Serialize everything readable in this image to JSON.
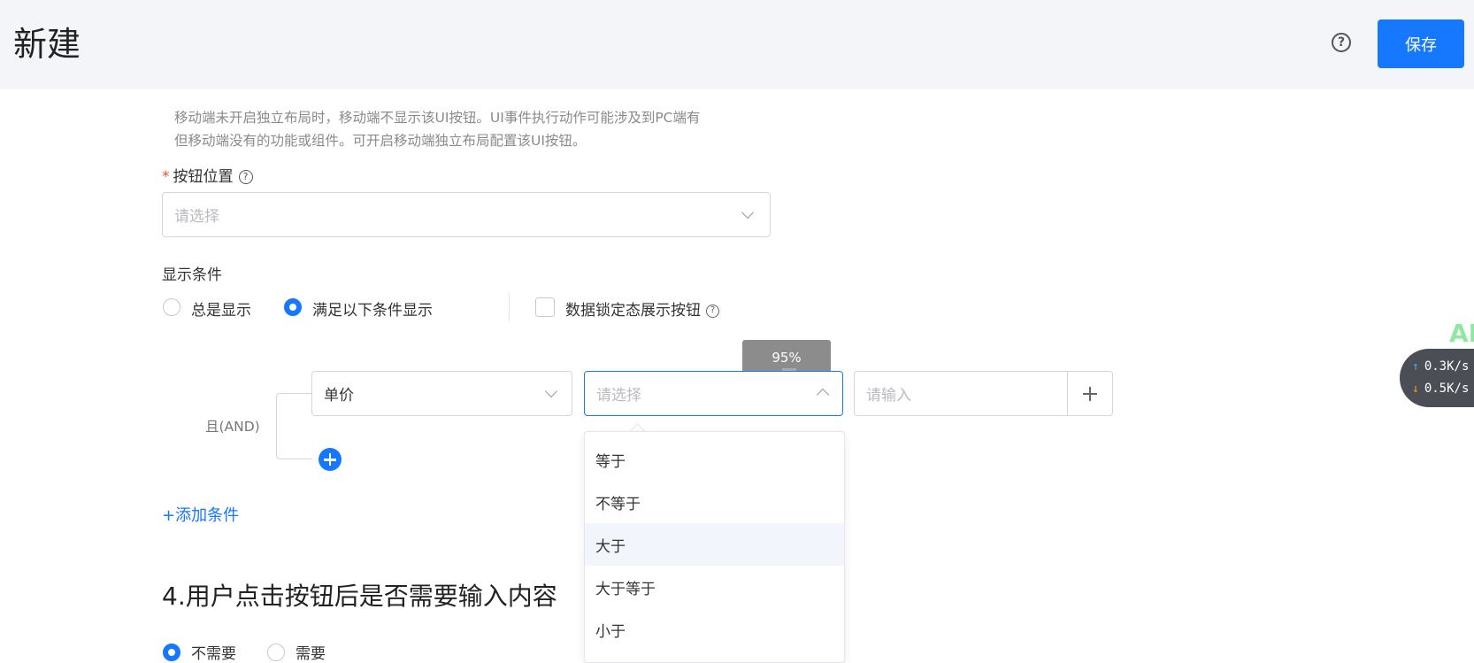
{
  "header": {
    "title": "新建",
    "save_label": "保存",
    "help_icon": "?"
  },
  "hint": {
    "line1": "移动端未开启独立布局时，移动端不显示该UI按钮。UI事件执行动作可能涉及到PC端有",
    "line2": "但移动端没有的功能或组件。可开启移动端独立布局配置该UI按钮。"
  },
  "button_position": {
    "required_mark": "*",
    "label": "按钮位置",
    "help_icon": "?",
    "placeholder": "请选择"
  },
  "display_condition": {
    "label": "显示条件",
    "options": [
      {
        "label": "总是显示",
        "selected": false
      },
      {
        "label": "满足以下条件显示",
        "selected": true
      }
    ],
    "lock_checkbox": {
      "label": "数据锁定态展示按钮",
      "checked": false,
      "help_icon": "?"
    }
  },
  "condition_group": {
    "logic_label": "且(AND)",
    "field_value": "单价",
    "operator_placeholder": "请选择",
    "value_placeholder": "请输入",
    "add_condition_link": "+添加条件"
  },
  "tooltip": {
    "text": "95%"
  },
  "operator_dropdown": {
    "options": [
      "等于",
      "不等于",
      "大于",
      "大于等于",
      "小于"
    ],
    "highlighted": "大于"
  },
  "section4": {
    "title": "4.用户点击按钮后是否需要输入内容",
    "options": [
      {
        "label": "不需要",
        "selected": true
      },
      {
        "label": "需要",
        "selected": false
      }
    ]
  },
  "net_speed": {
    "up": "0.3K/s",
    "down": "0.5K/s",
    "up_color": "#3ab0ff",
    "down_color": "#ff9f1c"
  },
  "overlay_text": "AI",
  "colors": {
    "primary": "#1677ff",
    "required": "#e8562a"
  }
}
